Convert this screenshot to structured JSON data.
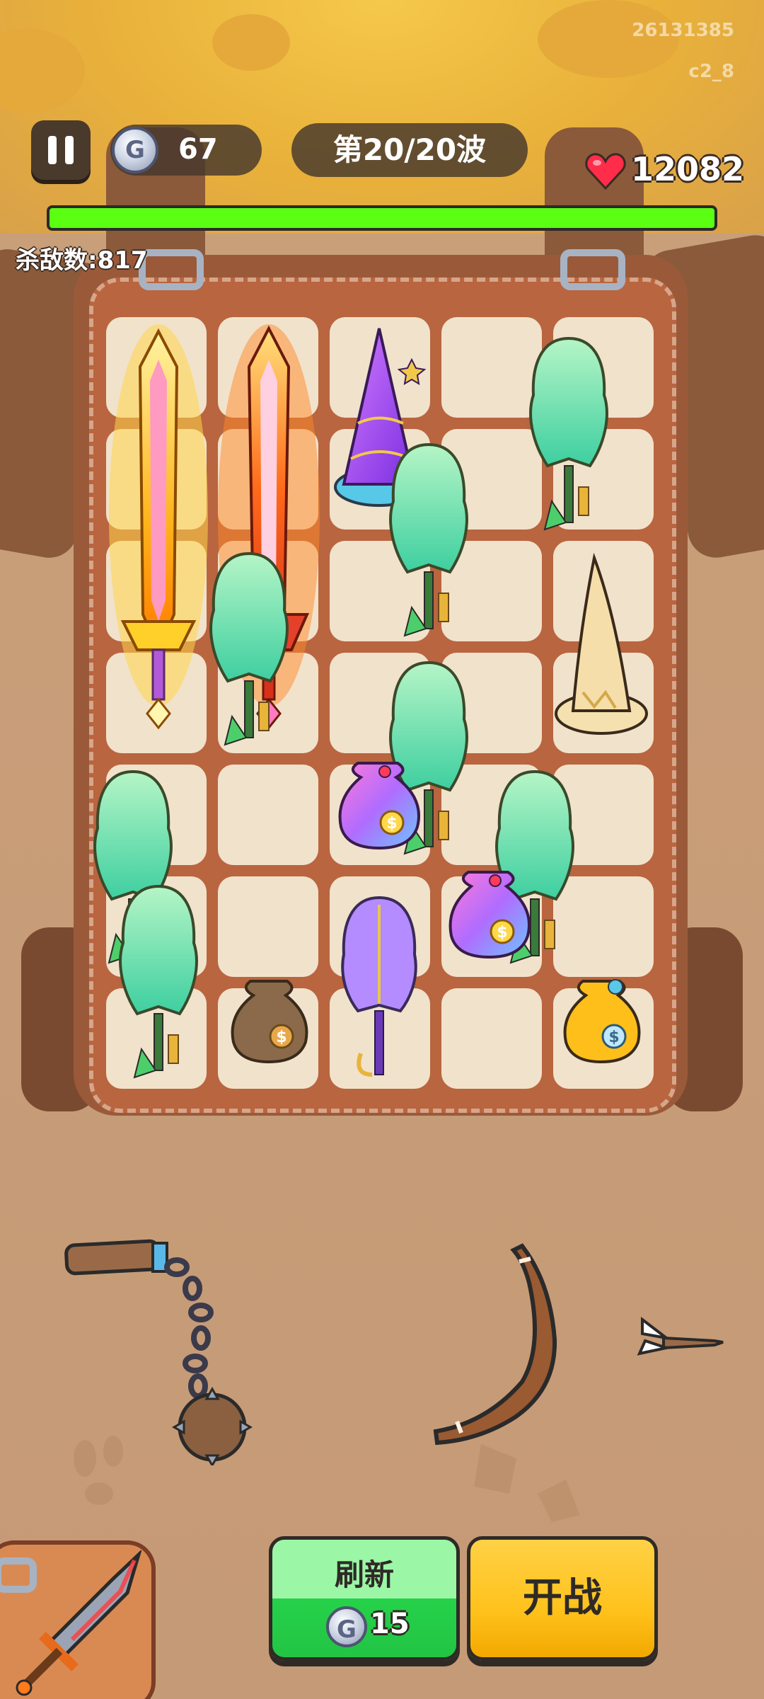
{
  "hud": {
    "build_id": "26131385",
    "build_tag": "c2_8",
    "coins": "67",
    "wave": "第20/20波",
    "hp": "12082",
    "kills": "杀敌数:817",
    "hp_bar_fill": 1.0
  },
  "backpack": {
    "rows": 7,
    "cols": 5,
    "items": [
      "flame-sword-gold",
      "flame-sword-red",
      "purple-wizard-hat",
      "jade-staff",
      "jade-staff",
      "jade-staff",
      "beige-wizard-hat",
      "jade-staff",
      "rainbow-money-bag",
      "jade-staff",
      "jade-staff",
      "rainbow-money-bag",
      "purple-staff",
      "brown-money-bag",
      "gold-money-bag"
    ]
  },
  "shop": {
    "items": [
      "flail",
      "boomerang",
      "dart"
    ]
  },
  "buttons": {
    "refresh_label": "刷新",
    "refresh_cost": "15",
    "fight_label": "开战"
  },
  "colors": {
    "hp_bar": "#5aff12",
    "refresh_button": "#26d24a",
    "fight_button": "#ffc21c",
    "backpack": "#b9653f"
  }
}
